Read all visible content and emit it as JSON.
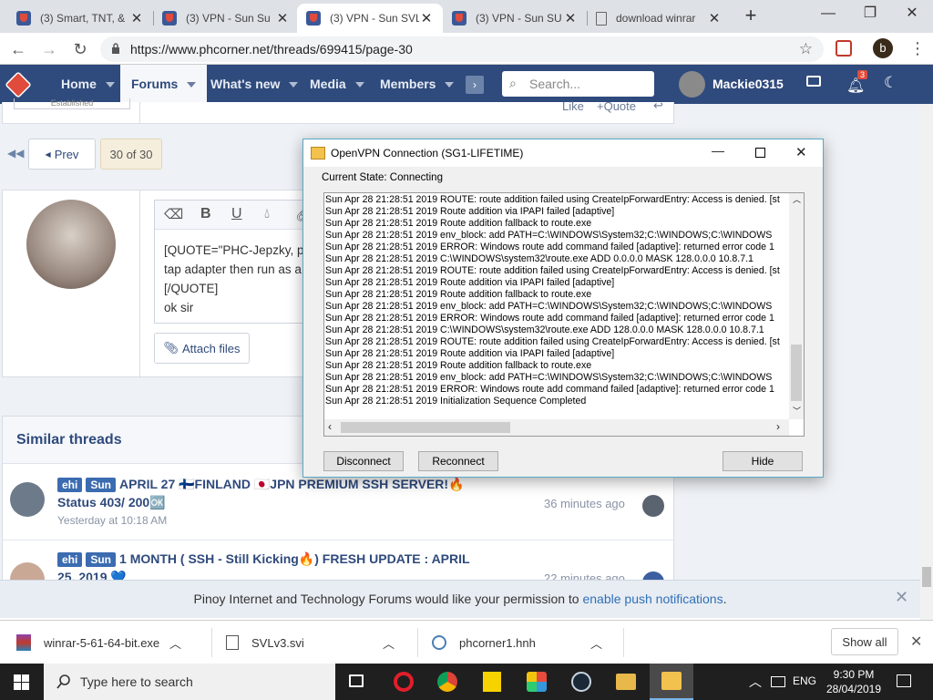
{
  "browser": {
    "tabs": [
      {
        "title": "(3) Smart, TNT, &",
        "icon": "shield-icon"
      },
      {
        "title": "(3) VPN - Sun Su",
        "icon": "shield-icon"
      },
      {
        "title": "(3) VPN - Sun SVL",
        "icon": "shield-icon"
      },
      {
        "title": "(3) VPN - Sun SU",
        "icon": "shield-icon"
      },
      {
        "title": "download winrar",
        "icon": "document-icon"
      }
    ],
    "active_tab": 2,
    "url": "https://www.phcorner.net/threads/699415/page-30",
    "profile_initial": "b"
  },
  "forum": {
    "nav": [
      "Home",
      "Forums",
      "What's new",
      "Media",
      "Members"
    ],
    "search_placeholder": "Search...",
    "username": "Mackie0315",
    "notif_count": "3",
    "post_top": {
      "established": "Established",
      "like": "Like",
      "quote": "+Quote"
    },
    "pagination": {
      "prev": "Prev",
      "current": "30 of 30"
    },
    "editor": {
      "lines": [
        "[QUOTE=\"PHC-Jepzky, po",
        "tap adapter then run as a",
        "[/QUOTE]",
        "ok sir"
      ],
      "attach": "Attach files"
    },
    "similar": {
      "heading": "Similar threads",
      "threads": [
        {
          "tags": [
            "ehi",
            "Sun"
          ],
          "title": "APRIL 27 🇫🇮FINLAND 🇯🇵JPN PREMIUM SSH SERVER!🔥",
          "title2": "Status 403/ 200🆗",
          "meta": "Yesterday at 10:18 AM",
          "ago": "36 minutes ago"
        },
        {
          "tags": [
            "ehi",
            "Sun"
          ],
          "title": "1 MONTH ( SSH - Still Kicking🔥) FRESH UPDATE : APRIL",
          "title2": "25, 2019 💙",
          "meta": "",
          "ago": "22 minutes ago"
        }
      ]
    },
    "push": {
      "text": "Pinoy Internet and Technology Forums would like your permission to ",
      "link": "enable push notifications",
      "end": "."
    }
  },
  "dialog": {
    "title": "OpenVPN Connection (SG1-LIFETIME)",
    "state": "Current State: Connecting",
    "log": [
      "Sun Apr 28 21:28:51 2019 ROUTE: route addition failed using CreateIpForwardEntry: Access is denied.   [st",
      "Sun Apr 28 21:28:51 2019 Route addition via IPAPI failed [adaptive]",
      "Sun Apr 28 21:28:51 2019 Route addition fallback to route.exe",
      "Sun Apr 28 21:28:51 2019 env_block: add PATH=C:\\WINDOWS\\System32;C:\\WINDOWS;C:\\WINDOWS",
      "Sun Apr 28 21:28:51 2019 ERROR: Windows route add command failed [adaptive]: returned error code 1",
      "Sun Apr 28 21:28:51 2019 C:\\WINDOWS\\system32\\route.exe ADD 0.0.0.0 MASK 128.0.0.0 10.8.7.1",
      "Sun Apr 28 21:28:51 2019 ROUTE: route addition failed using CreateIpForwardEntry: Access is denied.   [st",
      "Sun Apr 28 21:28:51 2019 Route addition via IPAPI failed [adaptive]",
      "Sun Apr 28 21:28:51 2019 Route addition fallback to route.exe",
      "Sun Apr 28 21:28:51 2019 env_block: add PATH=C:\\WINDOWS\\System32;C:\\WINDOWS;C:\\WINDOWS",
      "Sun Apr 28 21:28:51 2019 ERROR: Windows route add command failed [adaptive]: returned error code 1",
      "Sun Apr 28 21:28:51 2019 C:\\WINDOWS\\system32\\route.exe ADD 128.0.0.0 MASK 128.0.0.0 10.8.7.1",
      "Sun Apr 28 21:28:51 2019 ROUTE: route addition failed using CreateIpForwardEntry: Access is denied.   [st",
      "Sun Apr 28 21:28:51 2019 Route addition via IPAPI failed [adaptive]",
      "Sun Apr 28 21:28:51 2019 Route addition fallback to route.exe",
      "Sun Apr 28 21:28:51 2019 env_block: add PATH=C:\\WINDOWS\\System32;C:\\WINDOWS;C:\\WINDOWS",
      "Sun Apr 28 21:28:51 2019 ERROR: Windows route add command failed [adaptive]: returned error code 1",
      "Sun Apr 28 21:28:51 2019 Initialization Sequence Completed"
    ],
    "buttons": {
      "disconnect": "Disconnect",
      "reconnect": "Reconnect",
      "hide": "Hide"
    }
  },
  "downloads": {
    "items": [
      "winrar-5-61-64-bit.exe",
      "SVLv3.svi",
      "phcorner1.hnh"
    ],
    "show_all": "Show all"
  },
  "taskbar": {
    "search": "Type here to search",
    "lang": "ENG",
    "time": "9:30 PM",
    "date": "28/04/2019"
  },
  "colors": {
    "forum_nav": "#2f4a7c",
    "taskbar": "#1f1f1f",
    "dialog_border": "#5aa8c4"
  }
}
